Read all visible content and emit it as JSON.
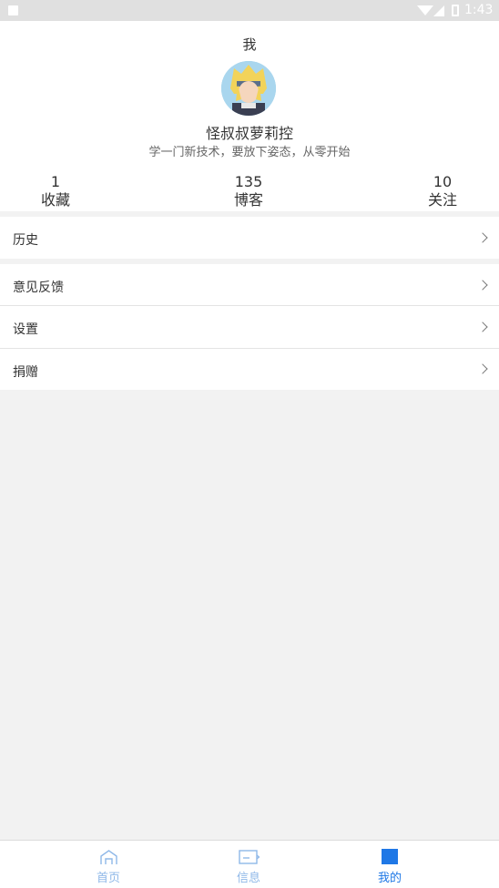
{
  "status_bar": {
    "time": "1:43"
  },
  "header": {
    "title": "我"
  },
  "profile": {
    "username": "怪叔叔萝莉控",
    "bio": "学一门新技术，要放下姿态，从零开始"
  },
  "stats": [
    {
      "value": "1",
      "label": "收藏"
    },
    {
      "value": "135",
      "label": "博客"
    },
    {
      "value": "10",
      "label": "关注"
    }
  ],
  "menu": [
    {
      "label": "历史"
    },
    {
      "label": "意见反馈"
    },
    {
      "label": "设置"
    },
    {
      "label": "捐赠"
    }
  ],
  "tabs": [
    {
      "label": "首页",
      "active": false
    },
    {
      "label": "信息",
      "active": false
    },
    {
      "label": "我的",
      "active": true
    }
  ],
  "colors": {
    "accent": "#1f78e6",
    "inactive": "#8fb8e8"
  }
}
